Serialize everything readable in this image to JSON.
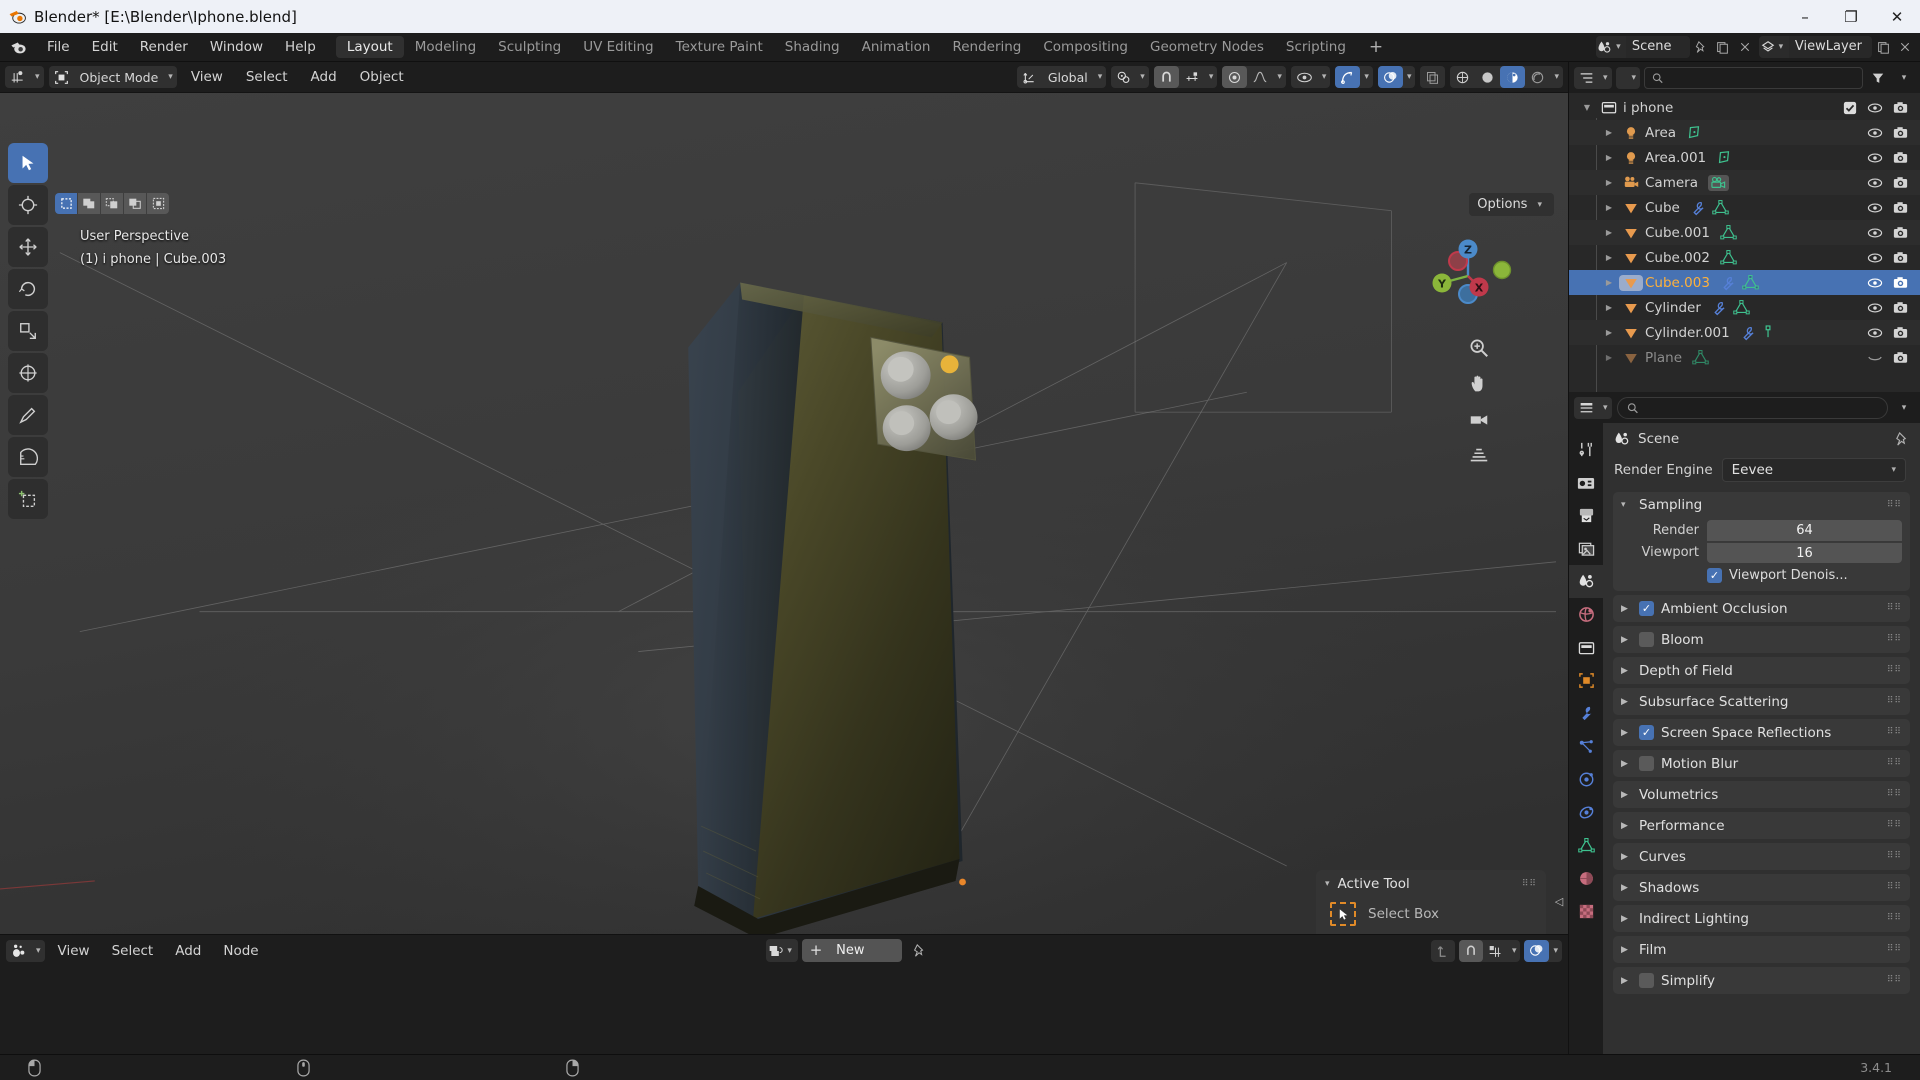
{
  "window": {
    "title": "Blender* [E:\\Blender\\Iphone.blend]",
    "minimize": "–",
    "maximize": "❐",
    "close": "✕"
  },
  "menubar": {
    "items": [
      "File",
      "Edit",
      "Render",
      "Window",
      "Help"
    ],
    "workspaces": [
      {
        "label": "Layout",
        "active": true
      },
      {
        "label": "Modeling",
        "active": false
      },
      {
        "label": "Sculpting",
        "active": false
      },
      {
        "label": "UV Editing",
        "active": false
      },
      {
        "label": "Texture Paint",
        "active": false
      },
      {
        "label": "Shading",
        "active": false
      },
      {
        "label": "Animation",
        "active": false
      },
      {
        "label": "Rendering",
        "active": false
      },
      {
        "label": "Compositing",
        "active": false
      },
      {
        "label": "Geometry Nodes",
        "active": false
      },
      {
        "label": "Scripting",
        "active": false
      }
    ],
    "add_workspace": "+",
    "scene_name": "Scene",
    "viewlayer_name": "ViewLayer"
  },
  "viewport_header": {
    "editor_type_icon": "editor-type-icon",
    "mode": "Object Mode",
    "menus": [
      "View",
      "Select",
      "Add",
      "Object"
    ],
    "transform_orientation": "Global",
    "snap_label": "snap",
    "proportional_label": "proportional-edit"
  },
  "viewport": {
    "options_label": "Options",
    "perspective_label": "User Perspective",
    "object_info": "(1) i phone | Cube.003",
    "gizmo_axes": [
      "X",
      "Y",
      "Z"
    ],
    "select_modes": [
      "set",
      "extend",
      "subtract",
      "invert",
      "intersect"
    ],
    "tools": [
      "tweak-tool",
      "cursor-tool",
      "move-tool",
      "rotate-tool",
      "scale-tool",
      "transform-tool",
      "annotate-tool",
      "measure-tool",
      "add-cube-tool"
    ]
  },
  "active_tool_panel": {
    "title": "Active Tool",
    "tool_name": "Select Box"
  },
  "shader_editor": {
    "menus": [
      "View",
      "Select",
      "Add",
      "Node"
    ],
    "new_button": "New",
    "plus": "+"
  },
  "outliner": {
    "search_placeholder": "",
    "items": [
      {
        "name": "i phone",
        "type": "collection",
        "depth": 0,
        "checkbox": true,
        "eye": true,
        "camera": true,
        "expanded": true,
        "selected": false,
        "dim": false,
        "extras": []
      },
      {
        "name": "Area",
        "type": "light",
        "depth": 1,
        "eye": true,
        "camera": true,
        "selected": false,
        "dim": false,
        "extras": [
          "light-data"
        ]
      },
      {
        "name": "Area.001",
        "type": "light",
        "depth": 1,
        "eye": true,
        "camera": true,
        "selected": false,
        "dim": false,
        "extras": [
          "light-data"
        ]
      },
      {
        "name": "Camera",
        "type": "camera",
        "depth": 1,
        "eye": true,
        "camera": true,
        "selected": false,
        "dim": false,
        "extras": [
          "camera-data"
        ]
      },
      {
        "name": "Cube",
        "type": "mesh",
        "depth": 1,
        "eye": true,
        "camera": true,
        "selected": false,
        "dim": false,
        "extras": [
          "modifier",
          "mesh-data"
        ]
      },
      {
        "name": "Cube.001",
        "type": "mesh",
        "depth": 1,
        "eye": true,
        "camera": true,
        "selected": false,
        "dim": false,
        "extras": [
          "mesh-data"
        ]
      },
      {
        "name": "Cube.002",
        "type": "mesh",
        "depth": 1,
        "eye": true,
        "camera": true,
        "selected": false,
        "dim": false,
        "extras": [
          "mesh-data"
        ]
      },
      {
        "name": "Cube.003",
        "type": "mesh",
        "depth": 1,
        "eye": true,
        "camera": true,
        "selected": true,
        "dim": false,
        "extras": [
          "modifier",
          "mesh-data"
        ]
      },
      {
        "name": "Cylinder",
        "type": "mesh",
        "depth": 1,
        "eye": true,
        "camera": true,
        "selected": false,
        "dim": false,
        "extras": [
          "modifier",
          "mesh-data"
        ]
      },
      {
        "name": "Cylinder.001",
        "type": "mesh",
        "depth": 1,
        "eye": true,
        "camera": true,
        "selected": false,
        "dim": false,
        "extras": [
          "modifier",
          "vertex-group"
        ]
      },
      {
        "name": "Plane",
        "type": "mesh",
        "depth": 1,
        "eye": false,
        "camera": true,
        "selected": false,
        "dim": true,
        "extras": [
          "mesh-data"
        ]
      }
    ]
  },
  "properties": {
    "search_placeholder": "",
    "breadcrumb": "Scene",
    "tabs": [
      "tool-tab",
      "render-tab",
      "output-tab",
      "view-layer-tab",
      "scene-tab",
      "world-tab",
      "collection-tab",
      "object-tab",
      "modifiers-tab",
      "particles-tab",
      "physics-tab",
      "constraints-tab",
      "data-tab",
      "material-tab",
      "texture-tab"
    ],
    "active_tab_index": 4,
    "render_engine_label": "Render Engine",
    "render_engine_value": "Eevee",
    "sampling": {
      "title": "Sampling",
      "render_label": "Render",
      "render_value": "64",
      "viewport_label": "Viewport",
      "viewport_value": "16",
      "denoise_label": "Viewport Denois...",
      "denoise_checked": true
    },
    "sections": [
      {
        "label": "Ambient Occlusion",
        "checkbox": true,
        "checked": true
      },
      {
        "label": "Bloom",
        "checkbox": true,
        "checked": false
      },
      {
        "label": "Depth of Field",
        "checkbox": false,
        "checked": false
      },
      {
        "label": "Subsurface Scattering",
        "checkbox": false,
        "checked": false
      },
      {
        "label": "Screen Space Reflections",
        "checkbox": true,
        "checked": true
      },
      {
        "label": "Motion Blur",
        "checkbox": true,
        "checked": false
      },
      {
        "label": "Volumetrics",
        "checkbox": false,
        "checked": false
      },
      {
        "label": "Performance",
        "checkbox": false,
        "checked": false
      },
      {
        "label": "Curves",
        "checkbox": false,
        "checked": false
      },
      {
        "label": "Shadows",
        "checkbox": false,
        "checked": false
      },
      {
        "label": "Indirect Lighting",
        "checkbox": false,
        "checked": false
      },
      {
        "label": "Film",
        "checkbox": false,
        "checked": false
      },
      {
        "label": "Simplify",
        "checkbox": true,
        "checked": false
      }
    ]
  },
  "statusbar": {
    "version": "3.4.1",
    "hints": [
      "",
      "",
      ""
    ]
  },
  "colors": {
    "accent_blue": "#4772b3",
    "orange": "#e08a28",
    "mesh_orange": "#ed9a4b",
    "green_data": "#3ec28f",
    "modifier_blue": "#5680d8",
    "selected_text": "#ffb13b"
  }
}
